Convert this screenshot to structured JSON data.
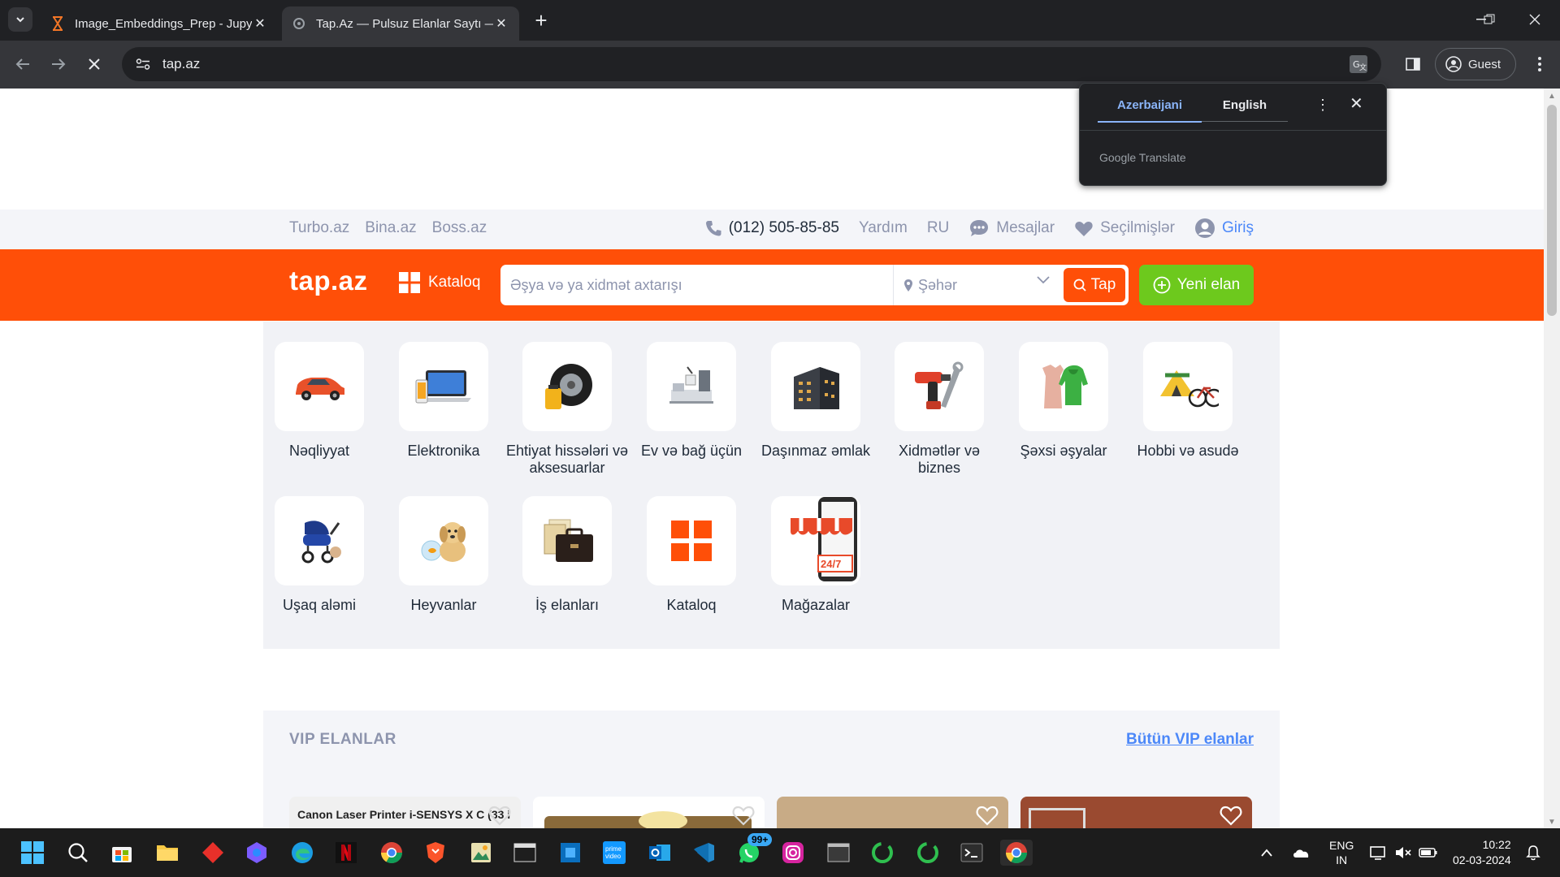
{
  "browser": {
    "tabs": [
      {
        "title": "Image_Embeddings_Prep - Jupy",
        "favicon": "hourglass-icon",
        "active": false
      },
      {
        "title": "Tap.Az — Pulsuz Elanlar Saytı —",
        "favicon": "chrome-loading-icon",
        "active": true
      }
    ],
    "address": "tap.az",
    "guest_label": "Guest"
  },
  "translate_popup": {
    "source_lang": "Azerbaijani",
    "target_lang": "English",
    "brand": "Google Translate"
  },
  "site": {
    "top_links": [
      "Turbo.az",
      "Bina.az",
      "Boss.az"
    ],
    "phone": "(012) 505-85-85",
    "help": "Yardım",
    "lang": "RU",
    "messages": "Mesajlar",
    "favorites": "Seçilmişlər",
    "login": "Giriş",
    "logo": "tap.az",
    "catalog": "Kataloq",
    "search_placeholder": "Əşya və ya xidmət axtarışı",
    "city_placeholder": "Şəhər",
    "search_button": "Tap",
    "new_ad": "Yeni elan",
    "categories_row1": [
      {
        "label": "Nəqliyyat",
        "icon": "car-icon"
      },
      {
        "label": "Elektronika",
        "icon": "laptop-icon"
      },
      {
        "label": "Ehtiyat hissələri və aksesuarlar",
        "icon": "tire-icon"
      },
      {
        "label": "Ev və bağ üçün",
        "icon": "home-furniture-icon"
      },
      {
        "label": "Daşınmaz əmlak",
        "icon": "building-icon"
      },
      {
        "label": "Xidmətlər və biznes",
        "icon": "tools-icon"
      },
      {
        "label": "Şəxsi əşyalar",
        "icon": "clothes-icon"
      },
      {
        "label": "Hobbi və asudə",
        "icon": "tent-bicycle-icon"
      }
    ],
    "categories_row2": [
      {
        "label": "Uşaq aləmi",
        "icon": "stroller-icon"
      },
      {
        "label": "Heyvanlar",
        "icon": "puppy-icon"
      },
      {
        "label": "İş elanları",
        "icon": "briefcase-icon"
      },
      {
        "label": "Kataloq",
        "icon": "grid-icon"
      },
      {
        "label": "Mağazalar",
        "icon": "store-icon"
      }
    ],
    "vip_title": "VIP ELANLAR",
    "vip_all": "Bütün VIP elanlar",
    "vip_card_1_text": "Canon Laser Printer i-SENSYS X C (33 i"
  },
  "taskbar": {
    "badge": "99+",
    "lang_line1": "ENG",
    "lang_line2": "IN",
    "time": "10:22",
    "date": "02-03-2024"
  },
  "colors": {
    "brand_orange": "#ff4f08",
    "new_ad_green": "#6dc91d",
    "link_blue": "#4c88f9",
    "muted_text": "#8d94ad"
  }
}
